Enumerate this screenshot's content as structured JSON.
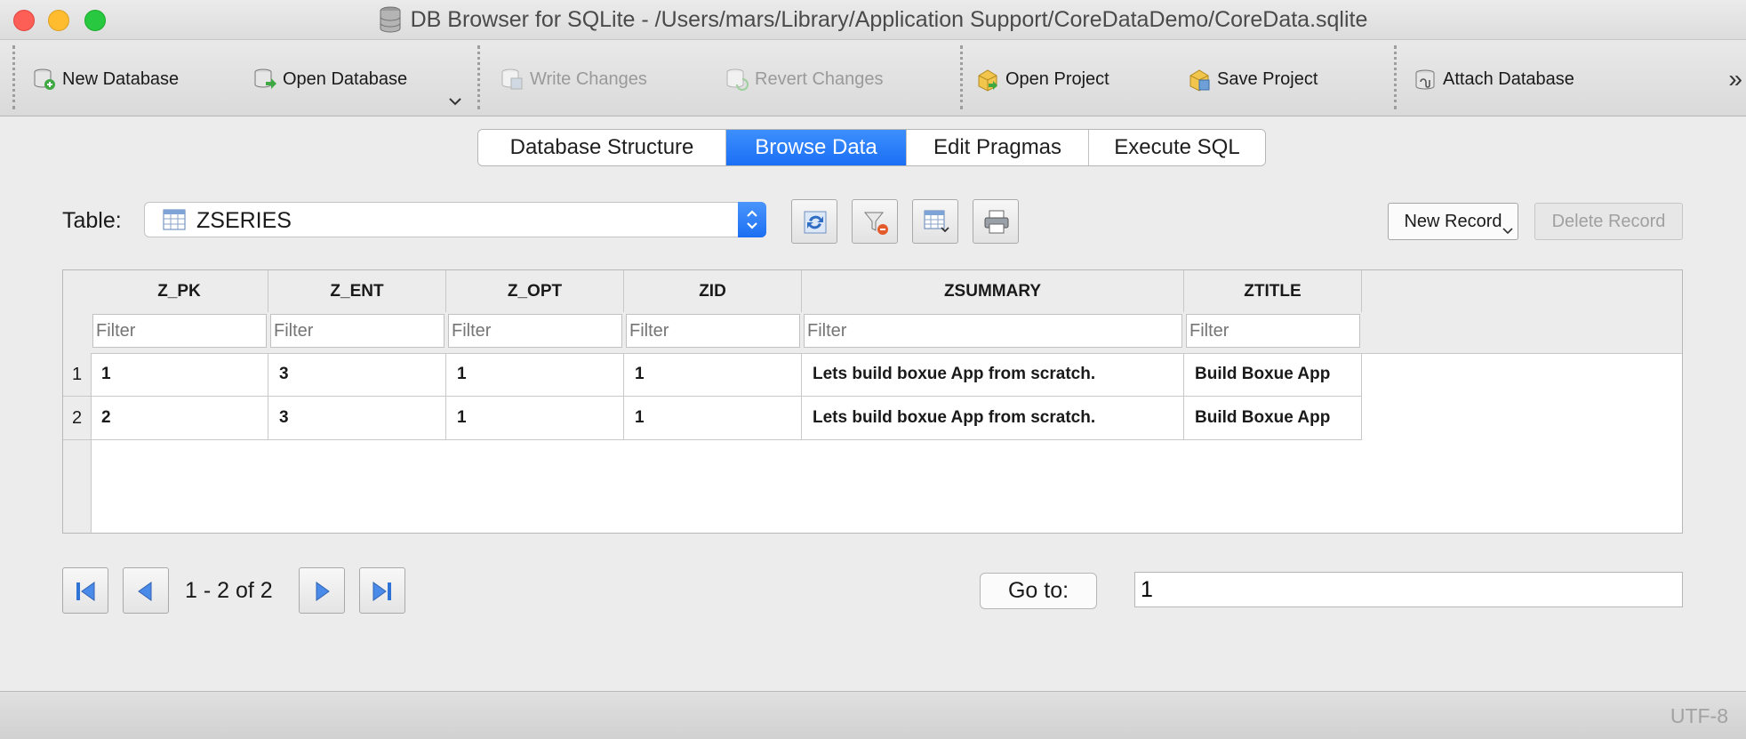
{
  "window": {
    "title": "DB Browser for SQLite - /Users/mars/Library/Application Support/CoreDataDemo/CoreData.sqlite"
  },
  "toolbar": {
    "new_database": "New Database",
    "open_database": "Open Database",
    "write_changes": "Write Changes",
    "revert_changes": "Revert Changes",
    "open_project": "Open Project",
    "save_project": "Save Project",
    "attach_database": "Attach Database",
    "overflow": "»"
  },
  "tabs": [
    {
      "label": "Database Structure",
      "active": false
    },
    {
      "label": "Browse Data",
      "active": true
    },
    {
      "label": "Edit Pragmas",
      "active": false
    },
    {
      "label": "Execute SQL",
      "active": false
    }
  ],
  "browse": {
    "table_label": "Table:",
    "selected_table": "ZSERIES",
    "new_record": "New Record",
    "delete_record": "Delete Record"
  },
  "grid": {
    "filter_placeholder": "Filter",
    "columns": [
      "Z_PK",
      "Z_ENT",
      "Z_OPT",
      "ZID",
      "ZSUMMARY",
      "ZTITLE"
    ],
    "row_numbers": [
      "1",
      "2"
    ],
    "rows": [
      [
        "1",
        "3",
        "1",
        "1",
        "Lets build boxue App from scratch.",
        "Build Boxue App"
      ],
      [
        "2",
        "3",
        "1",
        "1",
        "Lets build boxue App from scratch.",
        "Build Boxue App"
      ]
    ]
  },
  "navigation": {
    "range": "1 - 2 of 2",
    "goto_label": "Go to:",
    "goto_value": "1"
  },
  "status": {
    "encoding": "UTF-8"
  },
  "colors": {
    "accent": "#1b6ff5"
  }
}
